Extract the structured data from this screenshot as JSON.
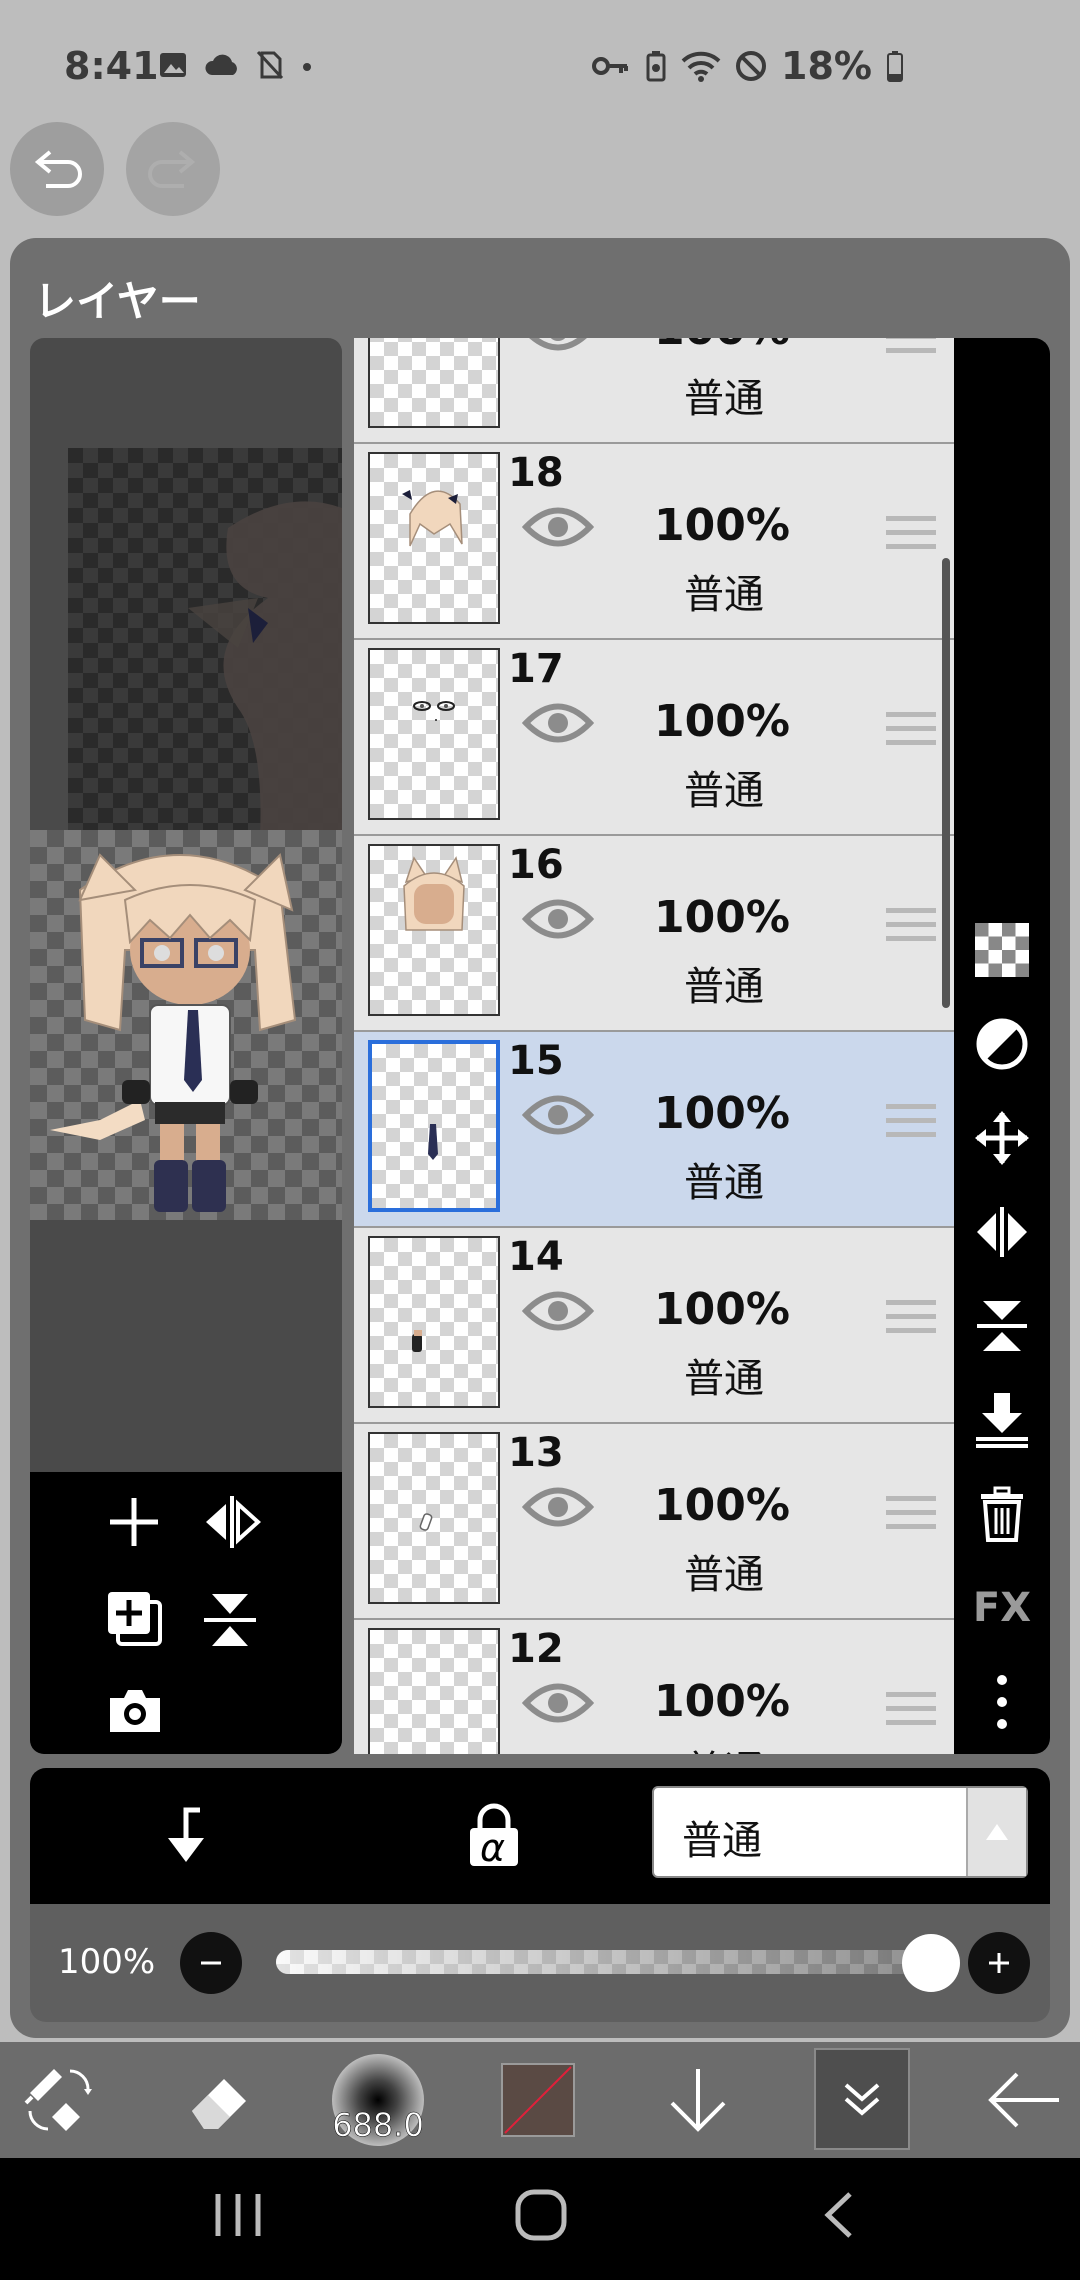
{
  "status_bar": {
    "time": "8:41",
    "battery": "18%",
    "left_icons": [
      "gallery-icon",
      "cloud-icon",
      "no-sim-icon",
      "dot-icon"
    ],
    "right_icons": [
      "key-icon",
      "battery-saver-icon",
      "wifi-icon",
      "do-not-disturb-icon",
      "battery-icon"
    ]
  },
  "panel": {
    "title": "レイヤー"
  },
  "layers": [
    {
      "number": "",
      "opacity": "100%",
      "mode": "普通",
      "selected": false
    },
    {
      "number": "18",
      "opacity": "100%",
      "mode": "普通",
      "selected": false
    },
    {
      "number": "17",
      "opacity": "100%",
      "mode": "普通",
      "selected": false
    },
    {
      "number": "16",
      "opacity": "100%",
      "mode": "普通",
      "selected": false
    },
    {
      "number": "15",
      "opacity": "100%",
      "mode": "普通",
      "selected": true
    },
    {
      "number": "14",
      "opacity": "100%",
      "mode": "普通",
      "selected": false
    },
    {
      "number": "13",
      "opacity": "100%",
      "mode": "普通",
      "selected": false
    },
    {
      "number": "12",
      "opacity": "100%",
      "mode": "普通",
      "selected": false
    }
  ],
  "side_tools": [
    "checkerboard-icon",
    "half-circle-icon",
    "move-icon",
    "flip-horizontal-icon",
    "flip-vertical-icon",
    "merge-down-icon",
    "trash-icon",
    "fx-label",
    "more-icon"
  ],
  "side_fx_label": "FX",
  "blend": {
    "value": "普通",
    "alpha_label": "α"
  },
  "opacity_control": {
    "value_text": "100%",
    "level": 0.95
  },
  "toolbar": {
    "brush_size": "688.0",
    "tools": [
      "transform-icon",
      "eraser-icon",
      "brush-size",
      "color-swatch",
      "down-arrow-icon",
      "collapse-icon",
      "back-arrow-icon"
    ]
  },
  "nav": [
    "recent-apps-icon",
    "home-icon",
    "back-icon"
  ],
  "colors": {
    "panel_bg": "#6f6f6f",
    "selected_row": "#cbd8ec",
    "selected_border": "#2a6edb",
    "color_swatch": "#5a4a44"
  }
}
